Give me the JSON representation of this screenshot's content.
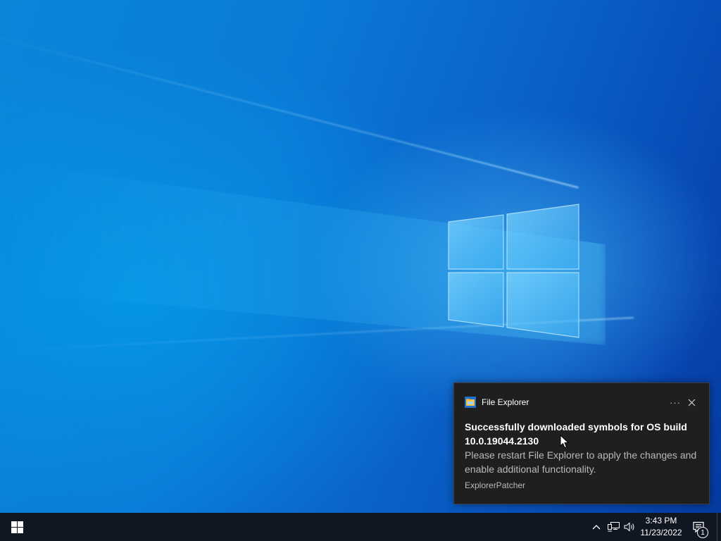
{
  "desktop": {
    "wallpaper": "windows-10-hero",
    "accent_color": "#0078d7"
  },
  "toast": {
    "app_icon": "file-explorer-icon",
    "app_name": "File Explorer",
    "more_label": "···",
    "close_icon": "close-icon",
    "title": "Successfully downloaded symbols for OS build 10.0.19044.2130",
    "body": "Please restart File Explorer to apply the changes and enable additional functionality.",
    "attribution": "ExplorerPatcher"
  },
  "taskbar": {
    "start_icon": "windows-start-icon",
    "tray_icons": [
      "chevron-up-icon",
      "network-icon",
      "volume-icon"
    ],
    "clock": {
      "time": "3:43 PM",
      "date": "11/23/2022"
    },
    "action_center": {
      "icon": "action-center-icon",
      "badge_count": "1"
    }
  }
}
